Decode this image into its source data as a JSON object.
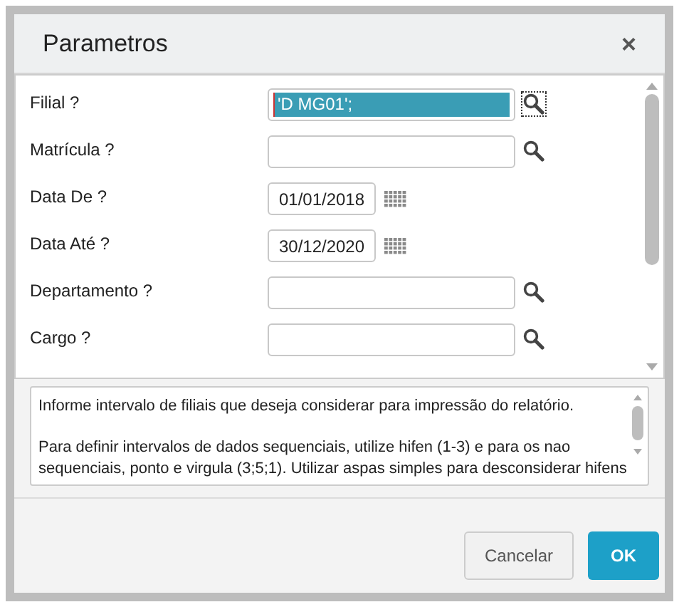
{
  "dialog": {
    "title": "Parametros",
    "close": "×"
  },
  "fields": [
    {
      "label": "Filial ?",
      "kind": "lookup",
      "value": "'D MG01';",
      "highlighted": true
    },
    {
      "label": "Matrícula ?",
      "kind": "lookup",
      "highlighted": false
    },
    {
      "label": "Data De ?",
      "kind": "date",
      "value": "01/01/2018",
      "highlighted": false
    },
    {
      "label": "Data Até ?",
      "kind": "date",
      "value": "30/12/2020",
      "highlighted": false
    },
    {
      "label": "Departamento ?",
      "kind": "lookup",
      "highlighted": false
    },
    {
      "label": "Cargo ?",
      "kind": "lookup",
      "highlighted": false
    }
  ],
  "help": {
    "paragraphs": [
      [
        "Informe intervalo de filiais que deseja considerar para impressão do relatório."
      ],
      [
        "Para definir intervalos de dados sequenciais, utilize hifen (1-3) e para os nao",
        "sequenciais, ponto e virgula (3;5;1). Utilizar aspas simples para desconsiderar hifens"
      ]
    ]
  },
  "buttons": [
    {
      "label": "Cancelar",
      "kind": "secondary"
    },
    {
      "label": "OK",
      "kind": "primary"
    }
  ]
}
